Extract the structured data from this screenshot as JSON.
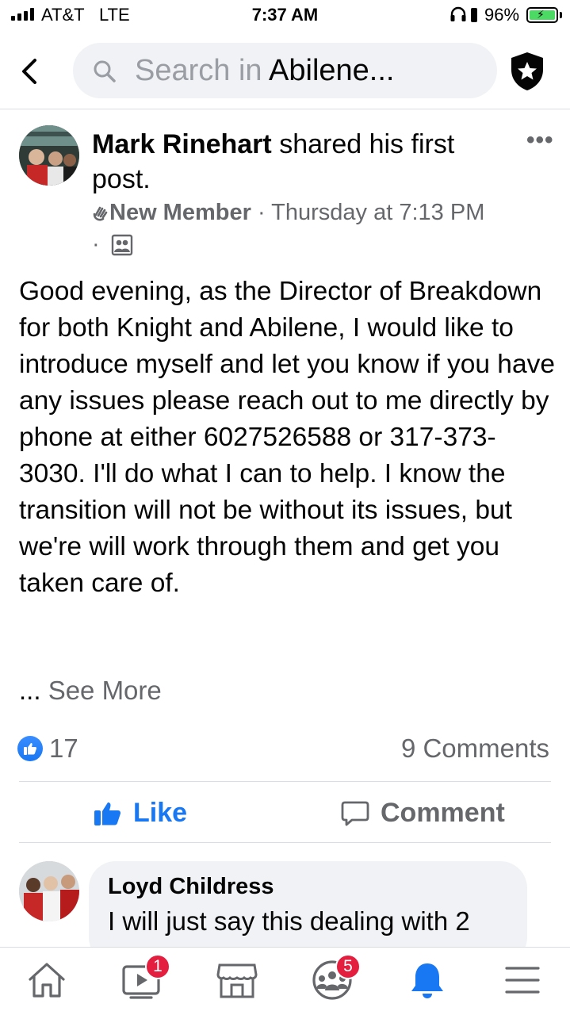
{
  "status_bar": {
    "carrier": "AT&T",
    "network": "LTE",
    "time": "7:37 AM",
    "battery": "96%",
    "icons": [
      "signal-icon",
      "headphones-icon",
      "rotation-lock-icon",
      "battery-charging-icon"
    ]
  },
  "header": {
    "back_icon": "chevron-left-icon",
    "search_placeholder": "Search in",
    "search_group": "Abilene...",
    "shield_icon": "admin-shield-icon"
  },
  "post": {
    "author": "Mark Rinehart",
    "action": "shared his first post.",
    "badge": "New Member",
    "timestamp": "Thursday at 7:13 PM",
    "separator": "·",
    "body": "Good evening, as the Director of Breakdown for both Knight and Abilene, I would like to introduce myself and let you know if you have any issues please reach out to me directly by phone at either 6027526588 or 317-373-3030. I'll do what I can to help. I know the transition will not be without its issues, but we're will work through them and get you taken care of.",
    "see_more_dots": "...",
    "see_more": "See More",
    "reaction_count": "17",
    "comments_count": "9 Comments",
    "like_label": "Like",
    "comment_label": "Comment"
  },
  "comment": {
    "author": "Loyd Childress",
    "text": "I will just say this dealing with 2"
  },
  "tab_bar": {
    "tabs": [
      {
        "name": "home-icon",
        "badge": ""
      },
      {
        "name": "watch-icon",
        "badge": "1"
      },
      {
        "name": "marketplace-icon",
        "badge": ""
      },
      {
        "name": "groups-icon",
        "badge": "5"
      },
      {
        "name": "notifications-icon",
        "badge": ""
      },
      {
        "name": "menu-icon",
        "badge": ""
      }
    ]
  },
  "colors": {
    "accent": "#1877f2",
    "secondary_text": "#65676b",
    "badge_red": "#e41e3f",
    "search_bg": "#f0f2f5"
  }
}
